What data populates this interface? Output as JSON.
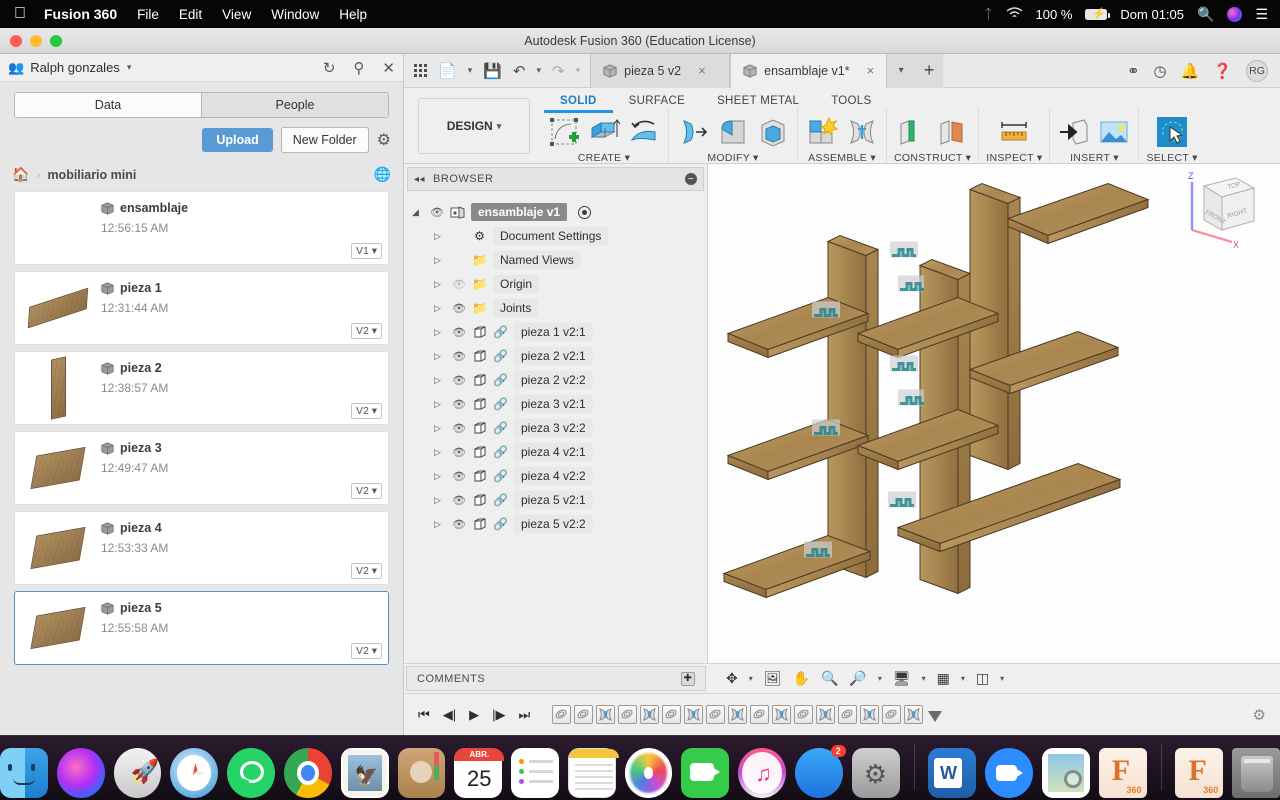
{
  "macbar": {
    "apple_icon": "apple-logo",
    "app_name": "Fusion 360",
    "menus": [
      "File",
      "Edit",
      "View",
      "Window",
      "Help"
    ],
    "bluetooth_icon": "bluetooth-icon",
    "wifi_icon": "wifi-icon",
    "battery_percent": "100 %",
    "battery_icon": "battery-charging-icon",
    "day_time": "Dom 01:05",
    "search_icon": "spotlight-search-icon",
    "siri_icon": "siri-icon",
    "controlcenter_icon": "notification-center-icon"
  },
  "window": {
    "title": "Autodesk Fusion 360 (Education License)"
  },
  "data_panel": {
    "group_icon": "people-group-icon",
    "user_name": "Ralph gonzales",
    "user_caret": "▾",
    "refresh_icon": "refresh-icon",
    "search_icon": "search-icon",
    "close_icon": "close-icon",
    "tabs": [
      {
        "label": "Data",
        "active": true
      },
      {
        "label": "People",
        "active": false
      }
    ],
    "upload_label": "Upload",
    "new_folder_label": "New Folder",
    "settings_icon": "gear-icon",
    "breadcrumb": {
      "home_icon": "home-icon",
      "separator": "›",
      "current": "mobiliario mini",
      "share_icon": "globe-share-icon"
    },
    "files": [
      {
        "name": "ensamblaje",
        "time": "12:56:15 AM",
        "version": "V1",
        "selected": false,
        "thumb": "none"
      },
      {
        "name": "pieza 1",
        "time": "12:31:44 AM",
        "version": "V2",
        "selected": false,
        "thumb": "plank-long"
      },
      {
        "name": "pieza 2",
        "time": "12:38:57 AM",
        "version": "V2",
        "selected": false,
        "thumb": "plank-tall"
      },
      {
        "name": "pieza 3",
        "time": "12:49:47 AM",
        "version": "V2",
        "selected": false,
        "thumb": "plank-flat"
      },
      {
        "name": "pieza 4",
        "time": "12:53:33 AM",
        "version": "V2",
        "selected": false,
        "thumb": "plank-flat"
      },
      {
        "name": "pieza 5",
        "time": "12:55:58 AM",
        "version": "V2",
        "selected": true,
        "thumb": "plank-flat"
      }
    ],
    "version_caret": "▾"
  },
  "quickbar": {
    "apps_icon": "app-grid-icon",
    "newfile_icon": "new-file-icon",
    "save_icon": "save-icon",
    "undo_icon": "undo-icon",
    "redo_icon": "redo-icon",
    "tabs": [
      {
        "label": "pieza 5 v2",
        "active": false,
        "close": "×"
      },
      {
        "label": "ensamblaje v1*",
        "active": true,
        "close": "×"
      }
    ],
    "tab_caret": "▾",
    "new_tab": "+",
    "job_status_icon": "job-status-icon",
    "recent_icon": "recent-clock-icon",
    "notifications_icon": "bell-icon",
    "help_icon": "help-icon",
    "avatar_initials": "RG"
  },
  "ribbon": {
    "workspace_label": "DESIGN",
    "workspace_caret": "▾",
    "tabs": [
      {
        "label": "SOLID",
        "active": true
      },
      {
        "label": "SURFACE",
        "active": false
      },
      {
        "label": "SHEET METAL",
        "active": false
      },
      {
        "label": "TOOLS",
        "active": false
      }
    ],
    "groups": [
      {
        "label": "CREATE",
        "caret": "▾",
        "icons": [
          "create-sketch-icon",
          "extrude-icon",
          "revolve-icon"
        ]
      },
      {
        "label": "MODIFY",
        "caret": "▾",
        "icons": [
          "press-pull-icon",
          "fillet-icon",
          "shell-icon"
        ]
      },
      {
        "label": "ASSEMBLE",
        "caret": "▾",
        "icons": [
          "new-component-icon",
          "joint-icon"
        ]
      },
      {
        "label": "CONSTRUCT",
        "caret": "▾",
        "icons": [
          "offset-plane-icon",
          "plane-angle-icon"
        ]
      },
      {
        "label": "INSPECT",
        "caret": "▾",
        "icons": [
          "measure-icon"
        ]
      },
      {
        "label": "INSERT",
        "caret": "▾",
        "icons": [
          "insert-derive-icon",
          "insert-canvas-icon"
        ]
      },
      {
        "label": "SELECT",
        "caret": "▾",
        "icons": [
          "select-freeform-icon"
        ]
      }
    ]
  },
  "browser": {
    "collapse_icon": "collapse-left-icon",
    "title": "BROWSER",
    "minimize_icon": "minimize-icon",
    "root": {
      "label": "ensamblaje v1",
      "eye_icon": "eye-icon",
      "component_icon": "assembly-icon",
      "activate_icon": "activate-radio-icon",
      "expander": "◢"
    },
    "nodes": [
      {
        "label": "Document Settings",
        "icon": "gear-icon",
        "eye": false,
        "link": false,
        "dim": false
      },
      {
        "label": "Named Views",
        "icon": "folder-icon",
        "eye": false,
        "link": false,
        "dim": false
      },
      {
        "label": "Origin",
        "icon": "folder-icon",
        "eye": true,
        "link": false,
        "dim": true
      },
      {
        "label": "Joints",
        "icon": "folder-icon",
        "eye": true,
        "link": false,
        "dim": false
      },
      {
        "label": "pieza 1 v2:1",
        "icon": "body-icon",
        "eye": true,
        "link": true,
        "dim": false
      },
      {
        "label": "pieza 2 v2:1",
        "icon": "body-icon",
        "eye": true,
        "link": true,
        "dim": false
      },
      {
        "label": "pieza 2 v2:2",
        "icon": "body-icon",
        "eye": true,
        "link": true,
        "dim": false
      },
      {
        "label": "pieza 3 v2:1",
        "icon": "body-icon",
        "eye": true,
        "link": true,
        "dim": false
      },
      {
        "label": "pieza 3 v2:2",
        "icon": "body-icon",
        "eye": true,
        "link": true,
        "dim": false
      },
      {
        "label": "pieza 4 v2:1",
        "icon": "body-icon",
        "eye": true,
        "link": true,
        "dim": false
      },
      {
        "label": "pieza 4 v2:2",
        "icon": "body-icon",
        "eye": true,
        "link": true,
        "dim": false
      },
      {
        "label": "pieza 5 v2:1",
        "icon": "body-icon",
        "eye": true,
        "link": true,
        "dim": false
      },
      {
        "label": "pieza 5 v2:2",
        "icon": "body-icon",
        "eye": true,
        "link": true,
        "dim": false
      }
    ],
    "expander_glyph": "▷"
  },
  "viewcube": {
    "top_face": "TOP",
    "front_face": "FRONT",
    "right_face": "RIGHT",
    "axis_z": "Z",
    "axis_x": "X"
  },
  "comments": {
    "label": "COMMENTS",
    "add_icon": "add-comment-icon"
  },
  "navbar": {
    "orbit_icon": "orbit-icon",
    "orbit_caret": "▾",
    "look_at_icon": "look-at-icon",
    "pan_icon": "pan-hand-icon",
    "zoom_icon": "zoom-icon",
    "fit_icon": "zoom-window-icon",
    "fit_caret": "▾",
    "display_icon": "display-settings-icon",
    "display_caret": "▾",
    "grid_icon": "grid-snap-icon",
    "grid_caret": "▾",
    "viewports_icon": "viewports-icon",
    "viewports_caret": "▾"
  },
  "timeline": {
    "first_icon": "go-to-beginning-icon",
    "prev_icon": "step-back-icon",
    "play_icon": "play-icon",
    "next_icon": "step-forward-icon",
    "last_icon": "go-to-end-icon",
    "features": [
      "sketch-icon",
      "sketch-icon",
      "joint-icon",
      "sketch-icon",
      "joint-icon",
      "sketch-icon",
      "joint-icon",
      "sketch-icon",
      "joint-icon",
      "sketch-icon",
      "joint-icon",
      "sketch-icon",
      "joint-icon",
      "sketch-icon",
      "joint-icon",
      "sketch-icon",
      "joint-icon"
    ],
    "settings_icon": "timeline-settings-icon"
  },
  "dock": {
    "items": [
      {
        "name": "finder",
        "running": true
      },
      {
        "name": "siri",
        "running": false
      },
      {
        "name": "launchpad",
        "running": false
      },
      {
        "name": "safari",
        "running": false
      },
      {
        "name": "whatsapp",
        "running": false
      },
      {
        "name": "chrome",
        "running": true
      },
      {
        "name": "mail",
        "running": false
      },
      {
        "name": "contacts",
        "running": false
      },
      {
        "name": "calendar",
        "running": false,
        "label": "ABR.",
        "day": "25"
      },
      {
        "name": "reminders",
        "running": false
      },
      {
        "name": "notes",
        "running": false
      },
      {
        "name": "photos",
        "running": false
      },
      {
        "name": "facetime",
        "running": false
      },
      {
        "name": "music",
        "running": false
      },
      {
        "name": "app-store",
        "running": false,
        "badge": "2"
      },
      {
        "name": "system-preferences",
        "running": true
      },
      {
        "name": "microsoft-word",
        "running": true
      },
      {
        "name": "zoom",
        "running": false
      },
      {
        "name": "preview",
        "running": false
      },
      {
        "name": "fusion-360",
        "running": true,
        "label": "360"
      },
      {
        "name": "fusion-360-alt",
        "running": false,
        "label": "360"
      },
      {
        "name": "trash",
        "running": false
      }
    ]
  }
}
